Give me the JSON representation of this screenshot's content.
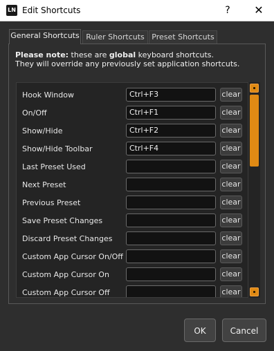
{
  "window": {
    "app_icon_text": "LN",
    "title": "Edit Shortcuts",
    "help_symbol": "?",
    "close_symbol": "✕"
  },
  "tabs": [
    {
      "label": "General Shortcuts",
      "active": true
    },
    {
      "label": "Ruler Shortcuts",
      "active": false
    },
    {
      "label": "Preset Shortcuts",
      "active": false
    }
  ],
  "note": {
    "bold_prefix": "Please note:",
    "text_before_global": " these are ",
    "bold_global": "global",
    "text_after_global": " keyboard shortcuts.",
    "line2": "They will override any previously set application shortcuts."
  },
  "clear_label": "clear",
  "shortcuts": [
    {
      "label": "Hook Window",
      "value": "Ctrl+F3"
    },
    {
      "label": "On/Off",
      "value": "Ctrl+F1"
    },
    {
      "label": "Show/Hide",
      "value": "Ctrl+F2"
    },
    {
      "label": "Show/Hide Toolbar",
      "value": "Ctrl+F4"
    },
    {
      "label": "Last Preset Used",
      "value": ""
    },
    {
      "label": "Next Preset",
      "value": ""
    },
    {
      "label": "Previous Preset",
      "value": ""
    },
    {
      "label": "Save Preset Changes",
      "value": ""
    },
    {
      "label": "Discard Preset Changes",
      "value": ""
    },
    {
      "label": "Custom App Cursor On/Off",
      "value": ""
    },
    {
      "label": "Custom App Cursor On",
      "value": ""
    },
    {
      "label": "Custom App Cursor Off",
      "value": ""
    }
  ],
  "buttons": {
    "ok": "OK",
    "cancel": "Cancel"
  },
  "colors": {
    "accent": "#e08a14",
    "background": "#2e2e2e",
    "field": "#121212"
  }
}
